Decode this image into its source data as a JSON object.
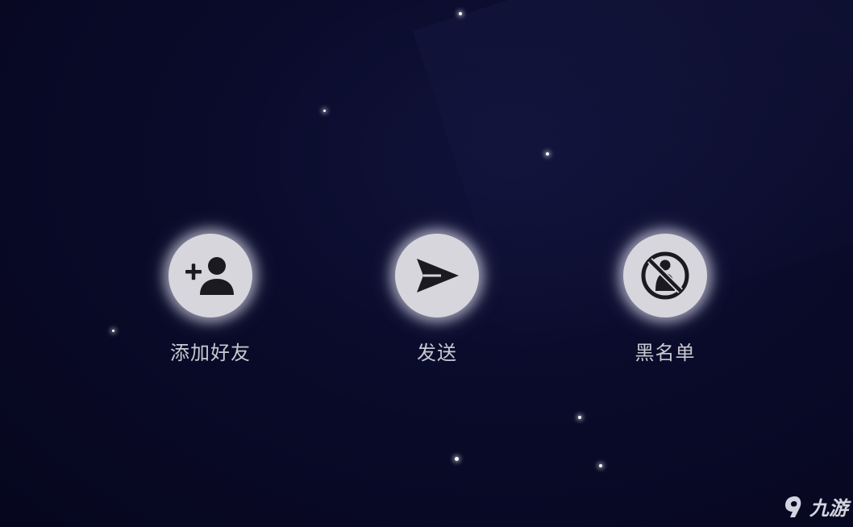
{
  "actions": [
    {
      "id": "add-friend",
      "label": "添加好友",
      "icon": "add-user-icon"
    },
    {
      "id": "send",
      "label": "发送",
      "icon": "send-icon"
    },
    {
      "id": "blacklist",
      "label": "黑名单",
      "icon": "block-user-icon"
    }
  ],
  "watermark": {
    "text": "九游",
    "icon": "jiuyou-logo-icon"
  },
  "colors": {
    "background": "#0a0b2a",
    "button": "#d6d6dc",
    "icon": "#1b1b1f",
    "label": "#c9c9d2"
  }
}
